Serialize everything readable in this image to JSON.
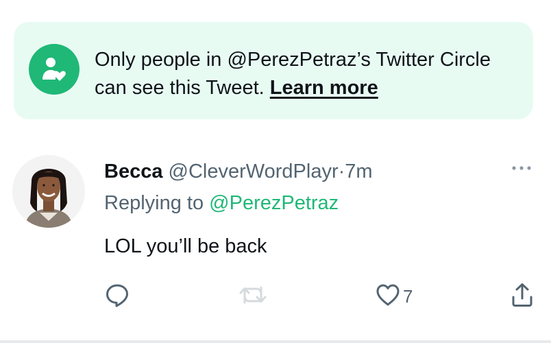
{
  "banner": {
    "text": "Only people in @PerezPetraz’s Twitter Circle can see this Tweet.",
    "link_label": "Learn more",
    "icon": "twitter-circle-person-heart-icon",
    "color": "#1fb877",
    "background": "#e8fbf3"
  },
  "tweet": {
    "author_name": "Becca",
    "author_handle": "@CleverWordPlayr",
    "separator": "·",
    "timestamp": "7m",
    "replying_label": "Replying to",
    "replying_handle": "@PerezPetraz",
    "text": "LOL you’ll be back",
    "avatar": "user-avatar-photo",
    "more_icon": "more-options-icon",
    "actions": {
      "reply_icon": "reply-icon",
      "retweet_icon": "retweet-icon",
      "like_icon": "heart-icon",
      "like_count": "7",
      "share_icon": "share-icon"
    }
  },
  "colors": {
    "text_primary": "#0f1419",
    "text_secondary": "#536471",
    "accent": "#1fb877"
  }
}
